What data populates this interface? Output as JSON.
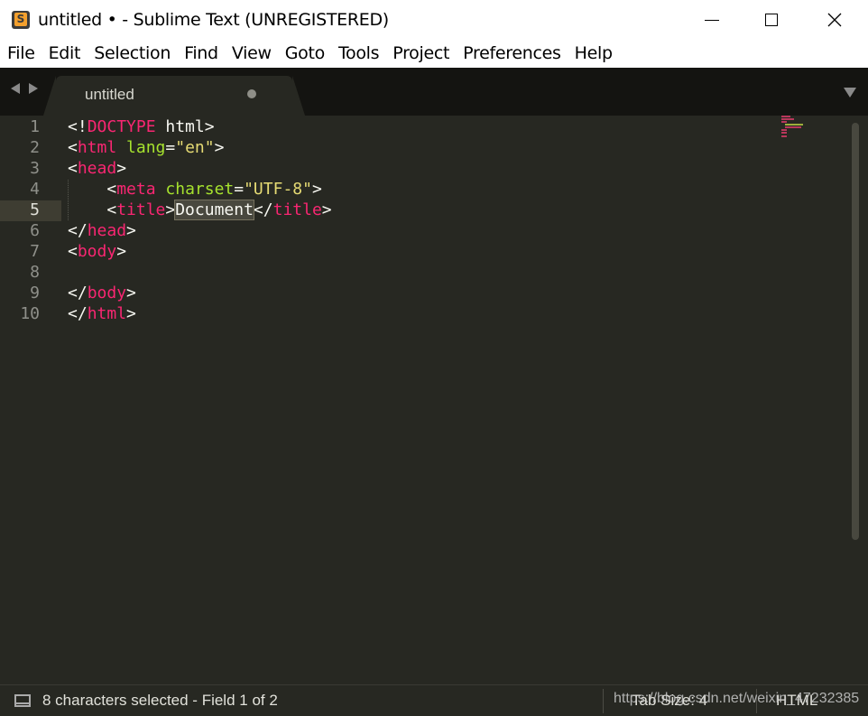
{
  "window": {
    "title": "untitled • - Sublime Text (UNREGISTERED)",
    "icon": "sublime-text-icon",
    "icon_letter": "S"
  },
  "menu": [
    {
      "label": "File"
    },
    {
      "label": "Edit"
    },
    {
      "label": "Selection"
    },
    {
      "label": "Find"
    },
    {
      "label": "View"
    },
    {
      "label": "Goto"
    },
    {
      "label": "Tools"
    },
    {
      "label": "Project"
    },
    {
      "label": "Preferences"
    },
    {
      "label": "Help"
    }
  ],
  "tab": {
    "label": "untitled",
    "dirty": true
  },
  "editor": {
    "line_numbers": [
      "1",
      "2",
      "3",
      "4",
      "5",
      "6",
      "7",
      "8",
      "9",
      "10"
    ],
    "current_line": 5,
    "code": [
      "<!DOCTYPE html>",
      "<html lang=\"en\">",
      "<head>",
      "    <meta charset=\"UTF-8\">",
      "    <title>Document</title>",
      "</head>",
      "<body>",
      "",
      "</body>",
      "</html>"
    ],
    "selected_text": "Document"
  },
  "colors": {
    "background": "#272822",
    "tag": "#f92672",
    "attribute": "#a6e22e",
    "string": "#e6db74",
    "text": "#f8f8f2",
    "gutter": "#8f908a"
  },
  "status": {
    "selection": "8 characters selected - Field 1 of 2",
    "tab_size": "Tab Size: 4",
    "syntax": "HTML"
  },
  "watermark": "https://blog.csdn.net/weixin_47232385"
}
